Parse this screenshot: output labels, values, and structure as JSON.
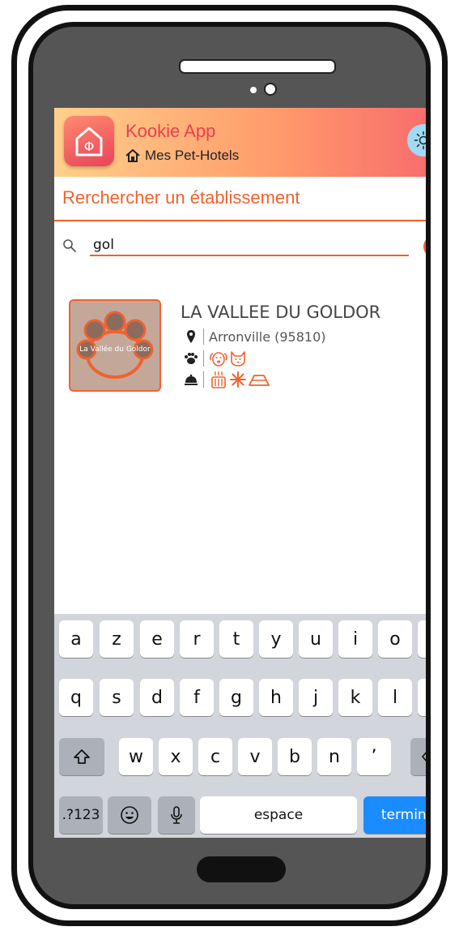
{
  "app": {
    "title": "Kookie App",
    "subtitle": "Mes Pet-Hotels",
    "logo_glyph": "Φ"
  },
  "search": {
    "section_title": "Rerchercher un établissement",
    "value": "gol"
  },
  "results": [
    {
      "name": "LA VALLEE DU GOLDOR",
      "location": "Arronville (95810)",
      "thumb_text": "La Vallée du Goldor",
      "animals": [
        "dog-icon",
        "cat-icon"
      ],
      "amenities": [
        "heating-icon",
        "air-conditioning-icon",
        "bowl-icon"
      ]
    }
  ],
  "keyboard": {
    "row1": [
      "a",
      "z",
      "e",
      "r",
      "t",
      "y",
      "u",
      "i",
      "o",
      "p"
    ],
    "row2": [
      "q",
      "s",
      "d",
      "f",
      "g",
      "h",
      "j",
      "k",
      "l",
      "m"
    ],
    "row3": [
      "w",
      "x",
      "c",
      "v",
      "b",
      "n",
      "’"
    ],
    "numbers_label": ".?123",
    "space_label": "espace",
    "done_label": "terminé"
  },
  "colors": {
    "accent": "#f0622f",
    "title": "#e8414f",
    "header_start": "#ffd08a",
    "header_end": "#f7656e",
    "theme_button": "#9fdcf4",
    "keyboard_bg": "#d2d5db",
    "done_key": "#1a8cff"
  }
}
